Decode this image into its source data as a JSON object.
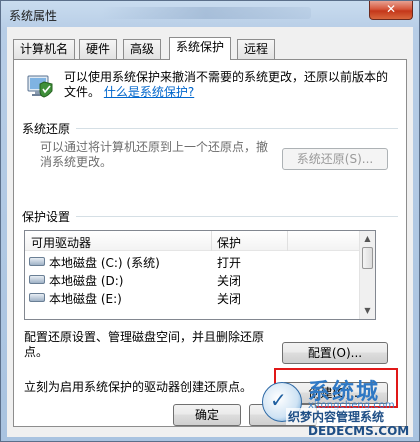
{
  "window": {
    "title": "系统属性",
    "close_glyph": "✕"
  },
  "tabs": [
    {
      "label": "计算机名",
      "active": false
    },
    {
      "label": "硬件",
      "active": false
    },
    {
      "label": "高级",
      "active": false
    },
    {
      "label": "系统保护",
      "active": true
    },
    {
      "label": "远程",
      "active": false
    }
  ],
  "intro": {
    "text": "可以使用系统保护来撤消不需要的系统更改，还原以前版本的文件。",
    "link": "什么是系统保护?"
  },
  "restore": {
    "group_label": "系统还原",
    "text": "可以通过将计算机还原到上一个还原点，撤消系统更改。",
    "button_label": "系统还原(S)..."
  },
  "protection": {
    "group_label": "保护设置",
    "columns": [
      "可用驱动器",
      "保护"
    ],
    "rows": [
      {
        "drive": "本地磁盘 (C:) (系统)",
        "protection": "打开"
      },
      {
        "drive": "本地磁盘 (D:)",
        "protection": "关闭"
      },
      {
        "drive": "本地磁盘 (E:)",
        "protection": "关闭"
      }
    ]
  },
  "config": {
    "text": "配置还原设置、管理磁盘空间，并且删除还原点。",
    "button_label": "配置(O)..."
  },
  "create": {
    "text": "立刻为启用系统保护的驱动器创建还原点。",
    "button_label": "创建(C)..."
  },
  "footer": {
    "ok_label": "确定",
    "cancel_label": "取"
  },
  "watermark": {
    "big": "系统城",
    "url": "xitongcheng.com",
    "brand": "织梦内容管理系统",
    "domain": "DEDECMS.COM"
  },
  "colors": {
    "highlight": "#e01818",
    "link": "#0066cc"
  }
}
